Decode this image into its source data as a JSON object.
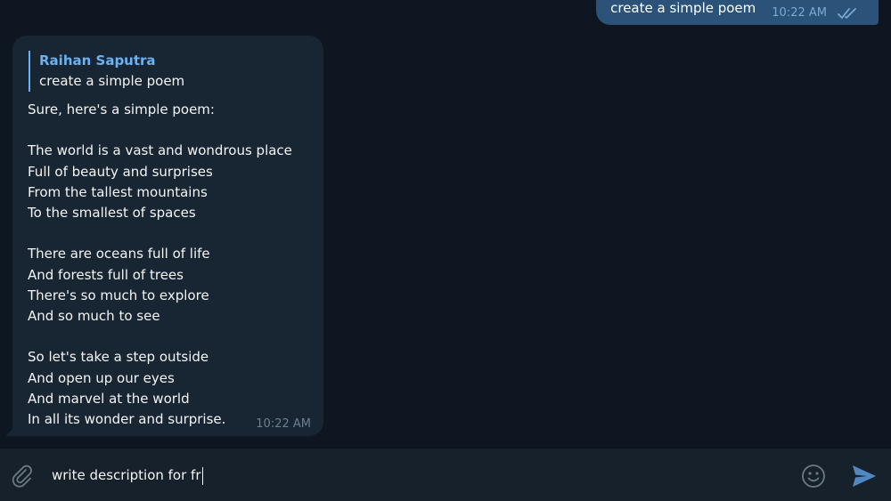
{
  "outgoing": {
    "text": "create a simple poem",
    "time": "10:22 AM",
    "status_icon": "double-check-icon"
  },
  "incoming": {
    "reply_to_name": "Raihan Saputra",
    "reply_to_text": "create a simple poem",
    "lines": [
      "Sure, here's a simple poem:",
      "",
      "The world is a vast and wondrous place",
      "Full of beauty and surprises",
      "From the tallest mountains",
      "To the smallest of spaces",
      "",
      "There are oceans full of life",
      "And forests full of trees",
      "There's so much to explore",
      "And so much to see",
      "",
      "So let's take a step outside",
      "And open up our eyes",
      "And marvel at the world",
      "In all its wonder and surprise."
    ],
    "time": "10:22 AM"
  },
  "composer": {
    "value": "write description for fr",
    "attach_icon": "paperclip-icon",
    "emoji_icon": "smiley-icon",
    "send_icon": "send-icon"
  },
  "colors": {
    "background": "#0e1621",
    "outgoing_bubble": "#2b5278",
    "incoming_bubble": "#182533",
    "accent": "#6ab2f2",
    "composer": "#17212b"
  }
}
